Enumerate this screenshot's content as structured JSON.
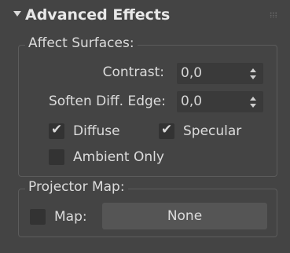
{
  "rollout": {
    "title": "Advanced Effects",
    "collapse_icon": "triangle-down",
    "grip_icon": "dot-grid"
  },
  "affect_surfaces": {
    "group_label": "Affect Surfaces:",
    "contrast": {
      "label": "Contrast:",
      "value": "0,0"
    },
    "soften_diff_edge": {
      "label": "Soften Diff. Edge:",
      "value": "0,0"
    },
    "diffuse": {
      "label": "Diffuse",
      "checked": true
    },
    "specular": {
      "label": "Specular",
      "checked": true
    },
    "ambient_only": {
      "label": "Ambient Only",
      "checked": false
    }
  },
  "projector_map": {
    "group_label": "Projector Map:",
    "map": {
      "label": "Map:",
      "checked": false,
      "button_label": "None"
    }
  },
  "colors": {
    "background": "#444444",
    "field_background": "#3a3a3a",
    "button_background": "#555555",
    "text": "#dcdcdc"
  }
}
